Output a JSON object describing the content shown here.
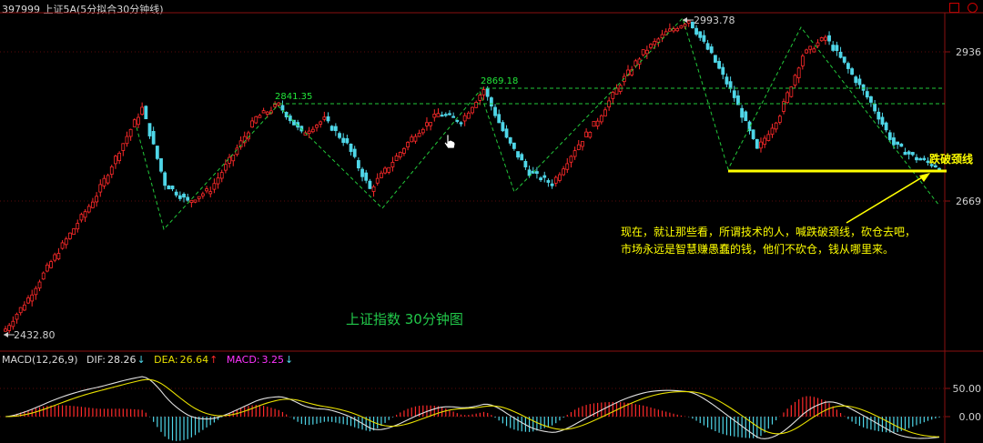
{
  "header": {
    "text": "397999 上证5A(5分拟合30分钟线)"
  },
  "macd_header": {
    "name": "MACD(12,26,9)",
    "dif_label": "DIF:",
    "dif_value": "28.26",
    "dea_label": "DEA:",
    "dea_value": "26.64",
    "macd_label": "MACD:",
    "macd_value": "3.25"
  },
  "chart_title": "上证指数 30分钟图",
  "annotation_text": {
    "line1": "现在，就让那些看，所谓技术的人，喊跌破颈线，砍仓去吧，",
    "line2": "市场永远是智慧赚愚蠢的钱，他们不砍仓，钱从哪里来。"
  },
  "neckline_callout": "跌破颈线",
  "price_labels": {
    "low": "2432.80",
    "high": "2993.78",
    "swing1": "2841.35",
    "swing2": "2869.18"
  },
  "axis_labels": {
    "y_high": "2936",
    "y_low": "2669",
    "macd_upper": "50.00",
    "macd_zero": "0.00"
  },
  "colors": {
    "up": "#ff2a2a",
    "down": "#4fd6e8",
    "zigzag": "#22c83a",
    "neckline": "#ffff00",
    "dif": "#e0e0e0",
    "dea": "#e8e000",
    "macd_label": "#ff33ff",
    "grid": "#8a1010"
  },
  "chart_data": {
    "type": "candlestick",
    "title": "上证指数 30分钟图",
    "price_low": 2432.8,
    "price_high": 2993.78,
    "key_levels": {
      "2841.35": 2841.35,
      "2869.18": 2869.18
    },
    "y_ticks": [
      2936,
      2669
    ],
    "close_path": [
      2440,
      2495,
      2560,
      2620,
      2680,
      2760,
      2835,
      2700,
      2668,
      2690,
      2752,
      2818,
      2841,
      2790,
      2815,
      2770,
      2690,
      2740,
      2790,
      2825,
      2812,
      2869,
      2780,
      2720,
      2700,
      2762,
      2815,
      2880,
      2935,
      2970,
      2993,
      2930,
      2855,
      2760,
      2825,
      2930,
      2962,
      2905,
      2845,
      2770,
      2745,
      2730
    ],
    "macd": {
      "dif": 28.26,
      "dea": 26.64,
      "macd": 3.25,
      "y_ticks": [
        50.0,
        0.0
      ]
    }
  }
}
